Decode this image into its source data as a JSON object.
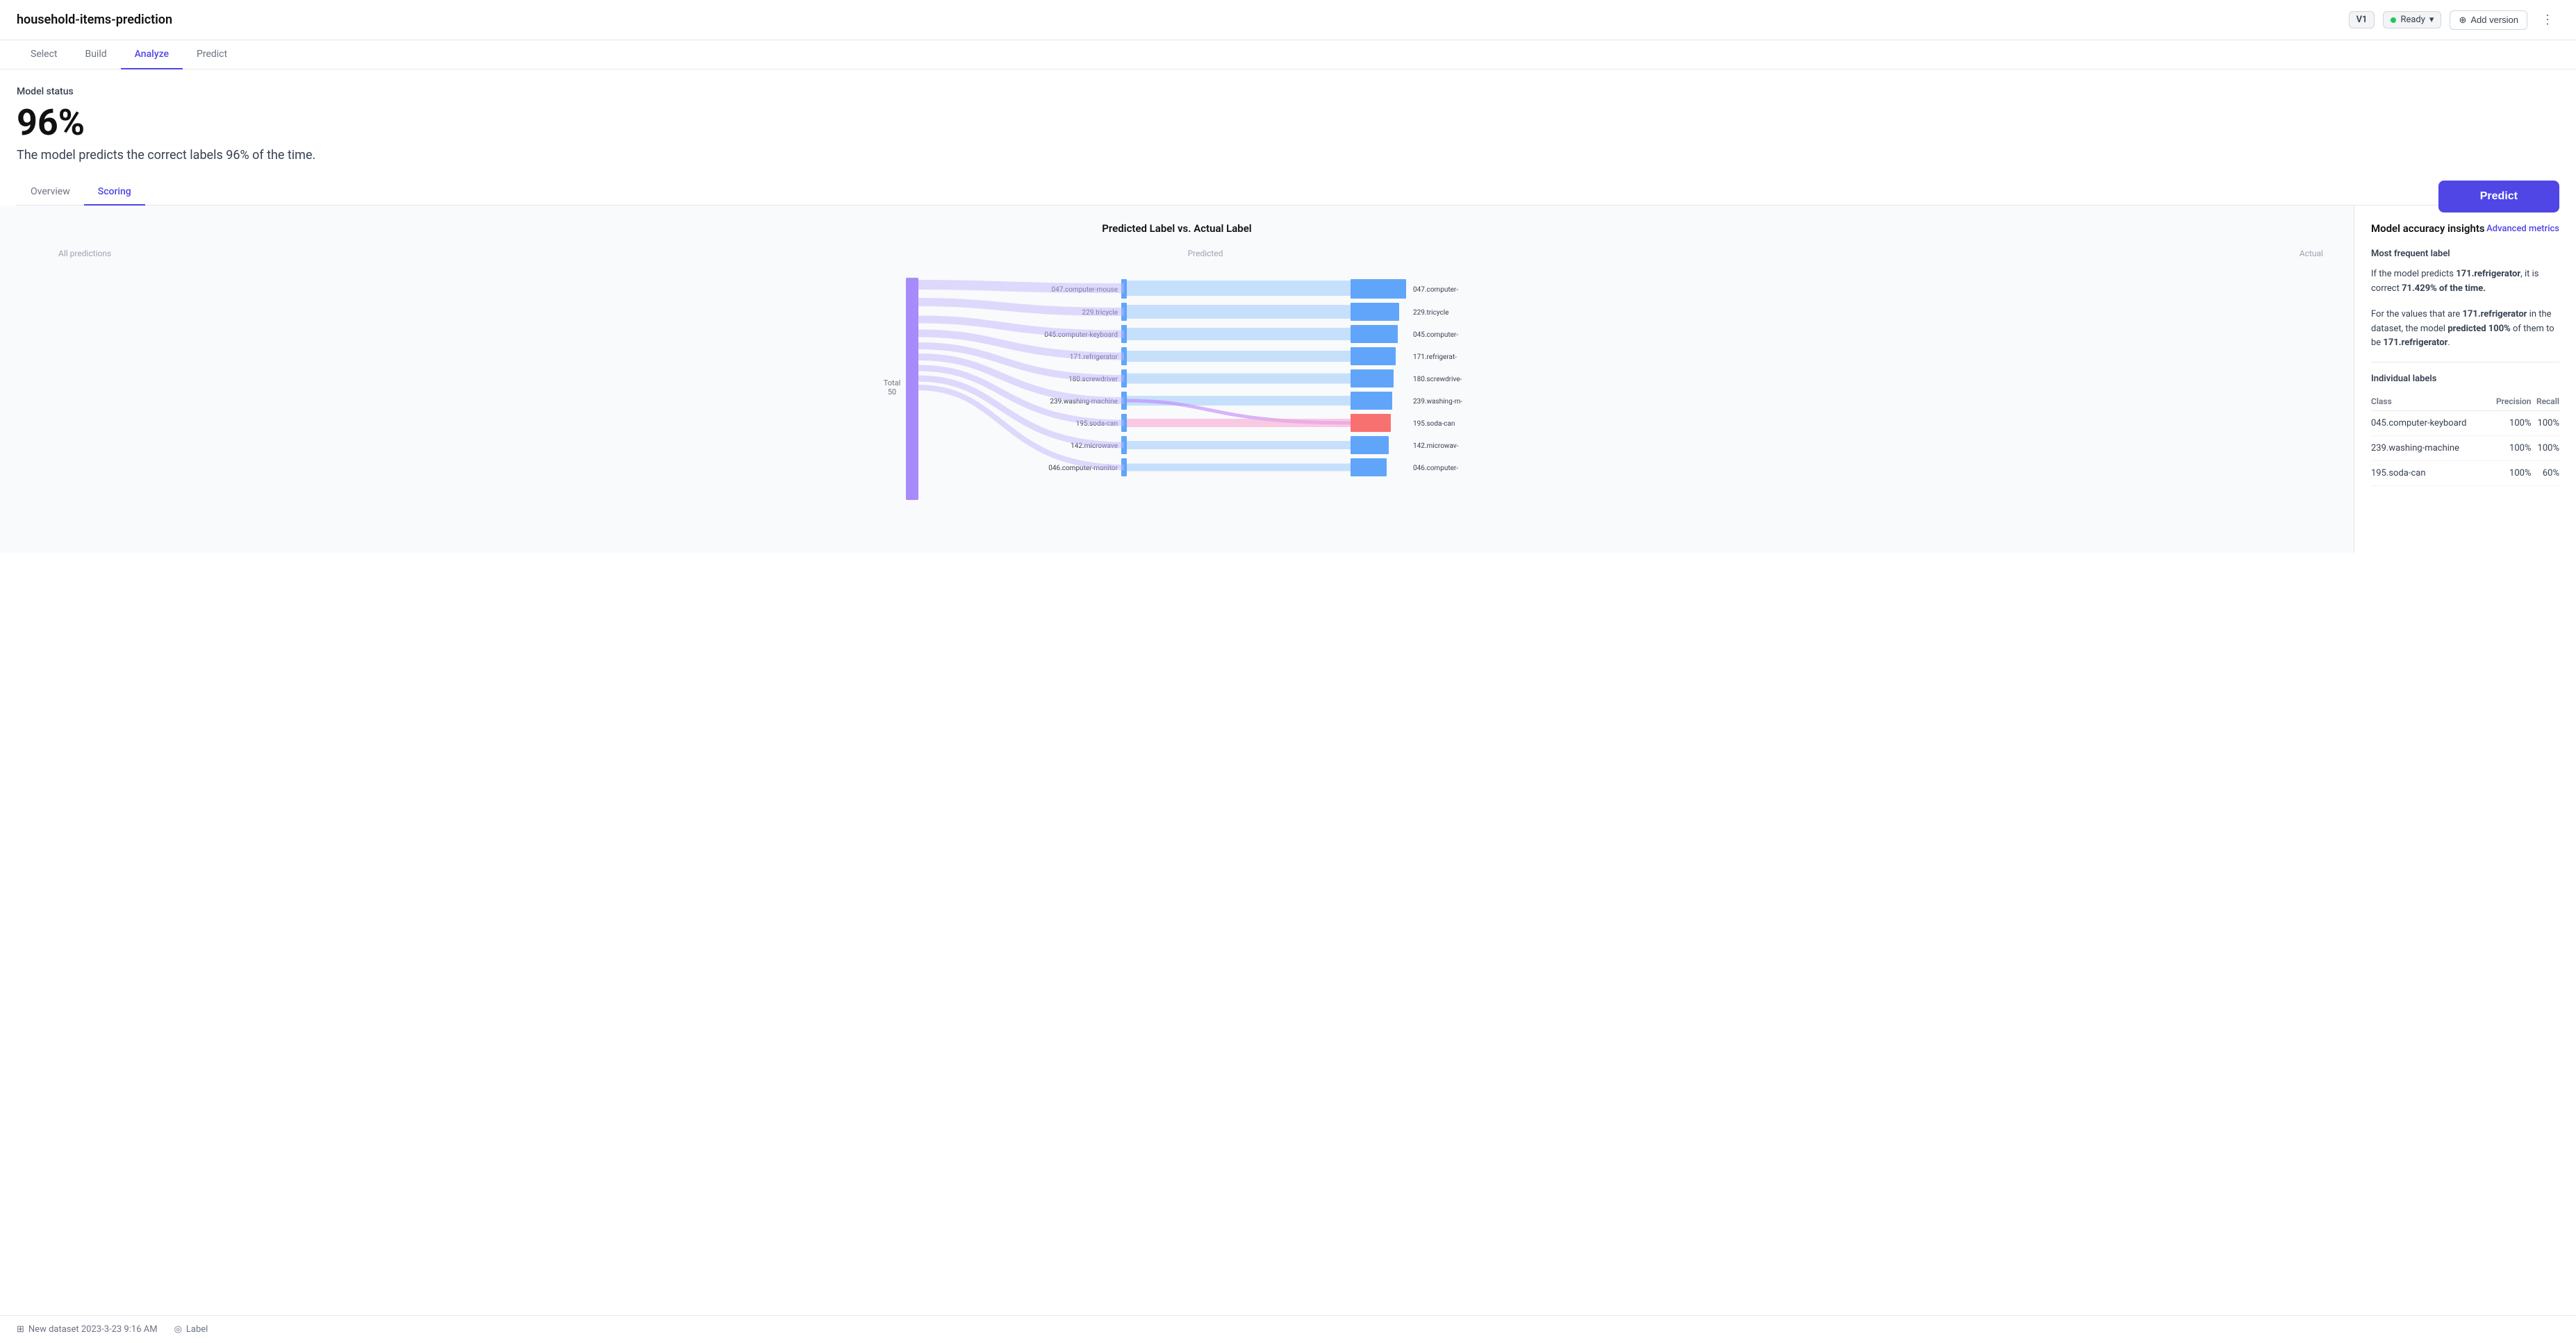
{
  "app": {
    "title": "household-items-prediction"
  },
  "header": {
    "version": "V1",
    "status": "Ready",
    "add_version_label": "Add version",
    "more_icon": "⋮"
  },
  "nav": {
    "tabs": [
      {
        "id": "select",
        "label": "Select",
        "active": false
      },
      {
        "id": "build",
        "label": "Build",
        "active": false
      },
      {
        "id": "analyze",
        "label": "Analyze",
        "active": true
      },
      {
        "id": "predict",
        "label": "Predict",
        "active": false
      }
    ]
  },
  "model_status": {
    "label": "Model status",
    "accuracy": "96%",
    "description": "The model predicts the correct labels 96% of the time."
  },
  "predict_button": "Predict",
  "sub_tabs": [
    {
      "id": "overview",
      "label": "Overview",
      "active": false
    },
    {
      "id": "scoring",
      "label": "Scoring",
      "active": true
    }
  ],
  "chart": {
    "title": "Predicted Label vs. Actual Label",
    "col_all": "All predictions",
    "col_predicted": "Predicted",
    "col_actual": "Actual",
    "total_label": "Total",
    "total_value": "50",
    "rows": [
      {
        "label": "047.computer-mouse",
        "actual": "047.computer-",
        "color": "#93c5fd",
        "width": 0.88
      },
      {
        "label": "229.tricycle",
        "actual": "229.tricycle",
        "color": "#93c5fd",
        "width": 0.75
      },
      {
        "label": "045.computer-keyboard",
        "actual": "045.computer-",
        "color": "#93c5fd",
        "width": 0.7
      },
      {
        "label": "171.refrigerator",
        "actual": "171.refrigerat-",
        "color": "#93c5fd",
        "width": 0.65
      },
      {
        "label": "180.screwdriver",
        "actual": "180.screwdrive-",
        "color": "#93c5fd",
        "width": 0.6
      },
      {
        "label": "239.washing-machine",
        "actual": "239.washing-m-",
        "color": "#93c5fd",
        "width": 0.58
      },
      {
        "label": "195.soda-can",
        "actual": "195.soda-can",
        "color": "#f87171",
        "width": 0.55
      },
      {
        "label": "142.microwave",
        "actual": "142.microwav-",
        "color": "#93c5fd",
        "width": 0.52
      },
      {
        "label": "046.computer-monitor",
        "actual": "046.computer-",
        "color": "#93c5fd",
        "width": 0.5
      }
    ]
  },
  "insights": {
    "title": "Model accuracy insights",
    "advanced_metrics": "Advanced metrics",
    "most_frequent_label": "Most frequent label",
    "insight_text_1": "If the model predicts 171.refrigerator, it is correct 71.429% of the time.",
    "insight_text_2": "For the values that are 171.refrigerator in the dataset, the model predicted 100% of them to be 171.refrigerator.",
    "insight_bold_1": "171.refrigerator",
    "insight_pct_1": "71.429%",
    "insight_bold_2": "171.refrigerator",
    "insight_pct_2": "100%",
    "insight_bold_3": "171.refrigerator",
    "individual_labels": "Individual labels",
    "table": {
      "headers": [
        "Class",
        "Precision",
        "Recall"
      ],
      "rows": [
        {
          "class": "045.computer-keyboard",
          "precision": "100%",
          "recall": "100%"
        },
        {
          "class": "239.washing-machine",
          "precision": "100%",
          "recall": "100%"
        },
        {
          "class": "195.soda-can",
          "precision": "100%",
          "recall": "60%"
        }
      ]
    }
  },
  "footer": {
    "dataset": "New dataset 2023-3-23 9:16 AM",
    "label_type": "Label"
  }
}
